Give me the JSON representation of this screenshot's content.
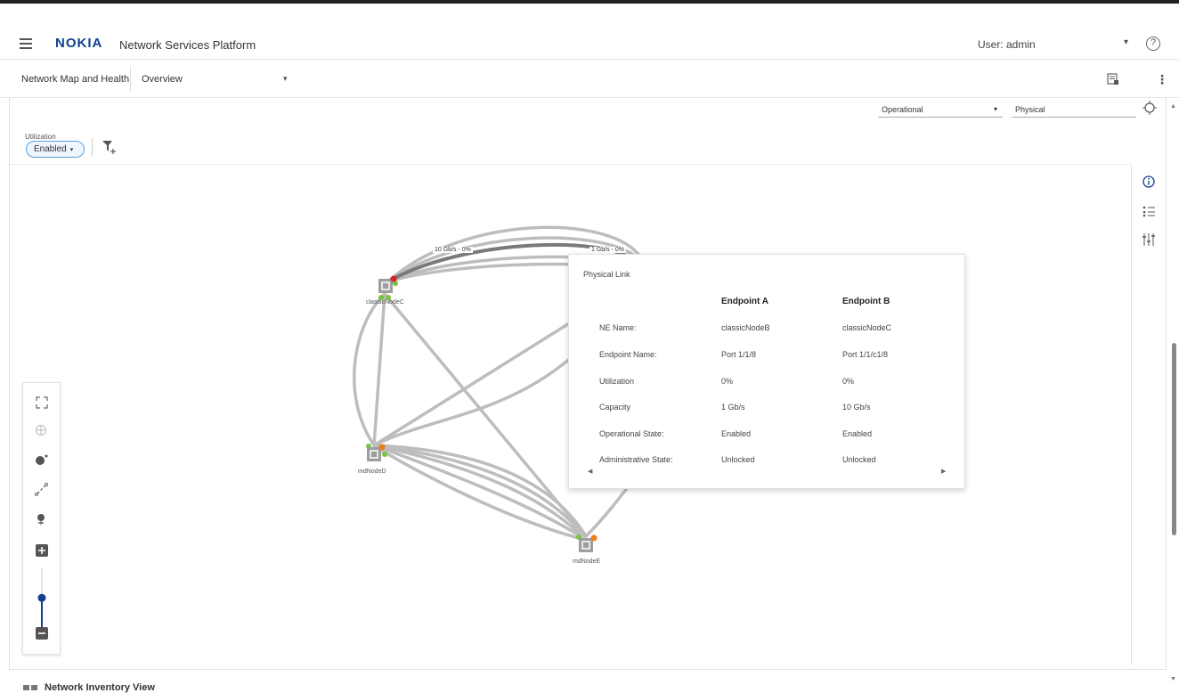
{
  "app": {
    "logo": "NOKIA",
    "title": "Network Services Platform",
    "user": "User: admin"
  },
  "subbar": {
    "crumb": "Network Map and Health",
    "view": "Overview"
  },
  "filters": {
    "state_select": "Operational",
    "layer_select": "Physical",
    "utilization_label": "Utilization",
    "utilization_value": "Enabled"
  },
  "map": {
    "nodes": [
      {
        "name": "classicNodeC",
        "status_color": "#d62424"
      },
      {
        "name": "mdNodeD",
        "status_color": "#f07d1a"
      },
      {
        "name": "mdNodeE",
        "status_color": "#f07d1a"
      }
    ],
    "link_labels": [
      "10 Gb/s - 0%",
      "1 Gb/s - 0%"
    ],
    "zoom_level": 0.55
  },
  "popup": {
    "title": "Physical Link",
    "headers": [
      "",
      "Endpoint A",
      "Endpoint B"
    ],
    "rows": [
      [
        "NE Name:",
        "classicNodeB",
        "classicNodeC"
      ],
      [
        "Endpoint Name:",
        "Port 1/1/8",
        "Port 1/1/c1/8"
      ],
      [
        "Utilization",
        "0%",
        "0%"
      ],
      [
        "Capacity",
        "1 Gb/s",
        "10 Gb/s"
      ],
      [
        "Operational State:",
        "Enabled",
        "Enabled"
      ],
      [
        "Administrative State:",
        "Unlocked",
        "Unlocked"
      ]
    ]
  },
  "footer": {
    "title": "Network Inventory View"
  },
  "colors": {
    "brand": "#124191",
    "accent": "#5aa0d8",
    "link": "#bdbdbd",
    "link_selected": "#7a7a7a",
    "endpoint": "#78c43c"
  },
  "icons": [
    "hamburger-icon",
    "help-icon",
    "report-icon",
    "kebab-icon",
    "locate-icon",
    "filter-add-icon",
    "info-icon",
    "list-icon",
    "sliders-icon",
    "fit-screen-icon",
    "grid-globe-icon",
    "node-add-icon",
    "link-edit-icon",
    "map-pin-icon",
    "zoom-in-icon",
    "zoom-out-icon"
  ]
}
